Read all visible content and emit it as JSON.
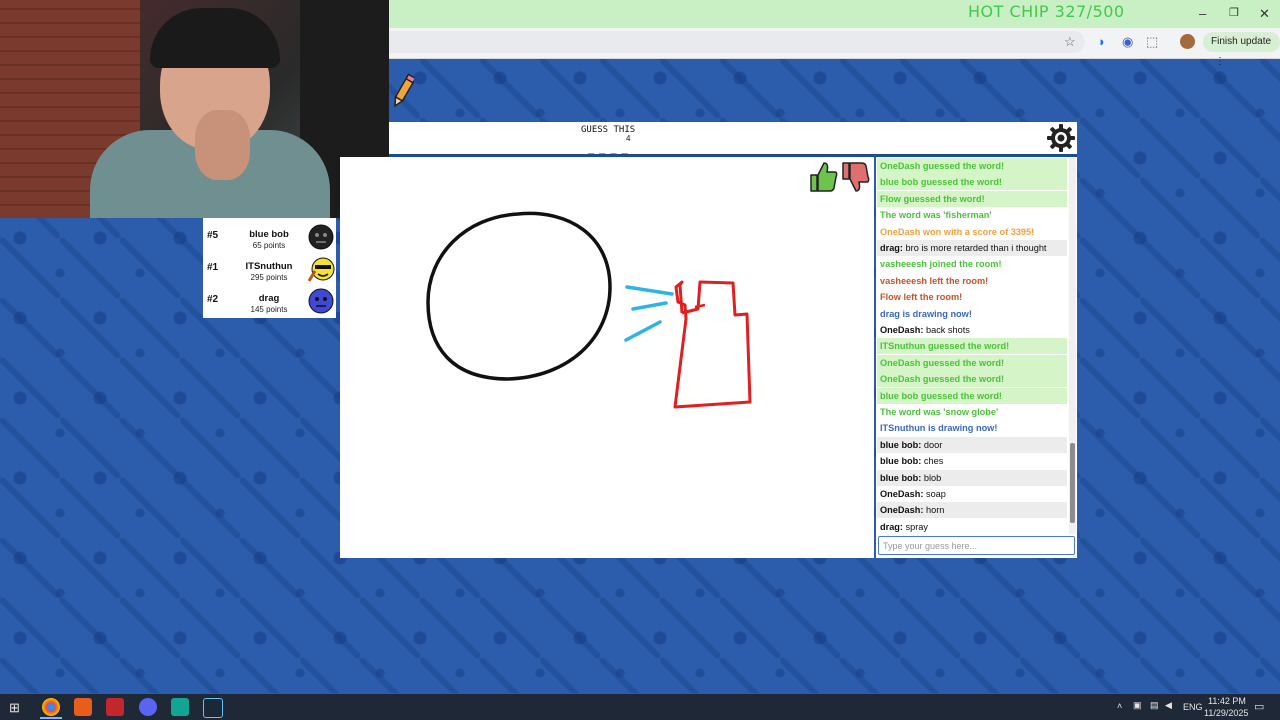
{
  "browser": {
    "overlay_title": "HOT CHIP 327/500",
    "finish_update_label": "Finish update",
    "minimize": "–",
    "restore": "❐",
    "close": "✕"
  },
  "game": {
    "guess_label": "GUESS THIS",
    "word_length": "4",
    "word_blanks": "_ _ _ _"
  },
  "scoreboard": [
    {
      "rank": "#5",
      "name": "blue bob",
      "points": "65 points",
      "avatar_color": "#222222"
    },
    {
      "rank": "#1",
      "name": "ITSnuthun",
      "points": "295 points",
      "avatar_color": "#f3e233"
    },
    {
      "rank": "#2",
      "name": "drag",
      "points": "145 points",
      "avatar_color": "#3f49d6"
    }
  ],
  "chat": {
    "messages": [
      {
        "text": "OneDash guessed the word!",
        "style": "green-bg"
      },
      {
        "text": "blue bob guessed the word!",
        "style": "green-bg"
      },
      {
        "text": "Flow guessed the word!",
        "style": "green-bg"
      },
      {
        "text": "The word was 'fisherman'",
        "style": "green-txt"
      },
      {
        "text": "OneDash won with a score of 3395!",
        "style": "orange-txt"
      },
      {
        "author": "drag:",
        "text": "bro is more retarded than i thought",
        "style": "plain"
      },
      {
        "text": "vasheeesh joined the room!",
        "style": "green-txt"
      },
      {
        "text": "vasheeesh left the room!",
        "style": "red-txt"
      },
      {
        "text": "Flow left the room!",
        "style": "red-txt"
      },
      {
        "text": "drag is drawing now!",
        "style": "blue-txt"
      },
      {
        "author": "OneDash:",
        "text": "back shots",
        "style": "plain"
      },
      {
        "text": "ITSnuthun guessed the word!",
        "style": "green-bg"
      },
      {
        "text": "OneDash guessed the word!",
        "style": "green-bg"
      },
      {
        "text": "OneDash guessed the word!",
        "style": "green-bg"
      },
      {
        "text": "blue bob guessed the word!",
        "style": "green-bg"
      },
      {
        "text": "The word was 'snow globe'",
        "style": "green-txt"
      },
      {
        "text": "ITSnuthun is drawing now!",
        "style": "blue-txt"
      },
      {
        "author": "blue bob:",
        "text": "door",
        "style": "plain"
      },
      {
        "author": "blue bob:",
        "text": "ches",
        "style": "plain"
      },
      {
        "author": "blue bob:",
        "text": "blob",
        "style": "plain"
      },
      {
        "author": "OneDash:",
        "text": "soap",
        "style": "plain"
      },
      {
        "author": "OneDash:",
        "text": "horn",
        "style": "plain"
      },
      {
        "author": "drag:",
        "text": "spray",
        "style": "plain"
      }
    ],
    "input_placeholder": "Type your guess here..."
  },
  "taskbar": {
    "lang": "ENG",
    "time": "11:42 PM",
    "date": "11/29/2025"
  },
  "colors": {
    "brand_blue": "#1c4c96",
    "chat_green": "#4cc23c",
    "drawing_red": "#e02020",
    "drawing_cyan": "#2db4e6"
  }
}
